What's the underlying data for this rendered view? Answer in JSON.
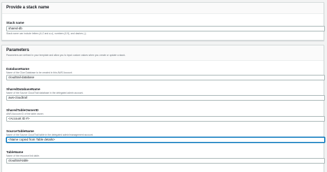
{
  "stack_name_panel": {
    "title": "Provide a stack name",
    "field_label": "Stack name",
    "value": "shared-db",
    "hint": "Stack name can include letters (A-Z and a-z), numbers (0-9), and dashes (-)."
  },
  "parameters_panel": {
    "title": "Parameters",
    "subtitle": "Parameters are defined in your template and allow you to input custom values when you create or update a stack.",
    "fields": [
      {
        "label": "DatabaseName",
        "description": "Name of the Glue Database to be created in this AWS Account.",
        "value": "cloudtrail-database"
      },
      {
        "label": "SharedDatabaseName",
        "description": "Name of the Source CloudTrail database in the delegated admin account.",
        "value": "aws-cloudtrail"
      },
      {
        "label": "SharedTableOwnerID",
        "description": "AWS Account ID of the table owner.",
        "value": "<Account ID #>"
      },
      {
        "label": "SourceTableName",
        "description": "Name of the Source CloudTrail table in the delegated admin/management account.",
        "value": "<Name copied from Table details>"
      },
      {
        "label": "TableName",
        "description": "Name of the resource link table.",
        "value": "cloudtrail-table"
      }
    ]
  }
}
